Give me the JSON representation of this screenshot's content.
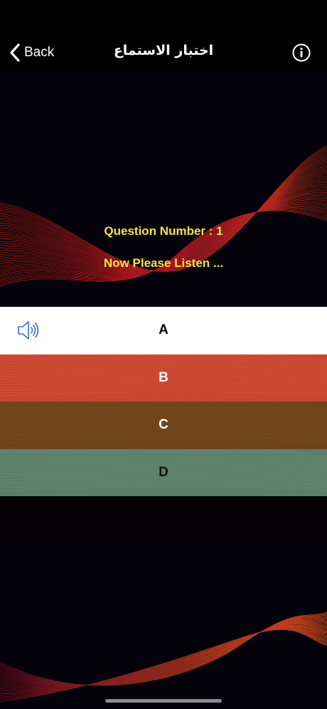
{
  "nav": {
    "back_label": "Back",
    "title": "اختبار الاستماع",
    "info_icon": "info-circle-icon"
  },
  "question": {
    "number_text": "Question Number : 1",
    "prompt_text": "Now Please Listen ..."
  },
  "options": [
    {
      "letter": "A",
      "color": "#ffffff",
      "has_speaker": true
    },
    {
      "letter": "B",
      "color": "#c84630"
    },
    {
      "letter": "C",
      "color": "#6e4318"
    },
    {
      "letter": "D",
      "color": "#5c7f6a"
    }
  ],
  "colors": {
    "accent_text": "#f7e43a",
    "speaker_icon": "#2f6fd6",
    "background": "#04030b"
  }
}
